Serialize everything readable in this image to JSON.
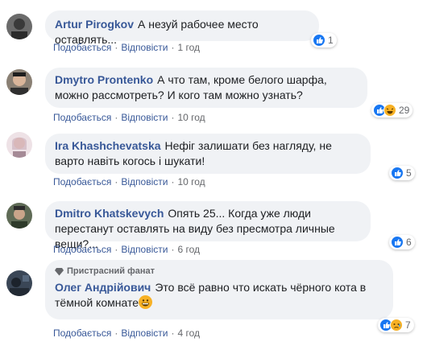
{
  "comments": [
    {
      "author": "Artur Pirogkov",
      "text": "А незуй рабочее место оставлять...",
      "actions": {
        "like": "Подобається",
        "reply": "Відповісти",
        "time": "1 год"
      },
      "reaction_count": "1",
      "avatar_color": "#4a4a4a"
    },
    {
      "author": "Dmytro Prontenko",
      "text": "А что там, кроме белого шарфа, можно рассмотреть? И кого там можно узнать?",
      "actions": {
        "like": "Подобається",
        "reply": "Відповісти",
        "time": "10 год"
      },
      "reaction_count": "29",
      "avatar_color": "#5c4a3a"
    },
    {
      "author": "Ira Khashchevatska",
      "text": "Нефіг залишати без нагляду, не варто навіть когось і шукати!",
      "actions": {
        "like": "Подобається",
        "reply": "Відповісти",
        "time": "10 год"
      },
      "reaction_count": "5",
      "avatar_color": "#d9b8c4"
    },
    {
      "author": "Dmitro Khatskevych",
      "text": "Опять 25... Когда уже люди перестанут оставлять на виду без пресмотра личные вещи?...",
      "actions": {
        "like": "Подобається",
        "reply": "Відповісти",
        "time": "6 год"
      },
      "reaction_count": "6",
      "avatar_color": "#3e4a3a"
    },
    {
      "badge": "Пристрасний фанат",
      "author": "Олег Андрійович",
      "text": "Это всё равно что искать чёрного кота в тёмной комнате",
      "actions": {
        "like": "Подобається",
        "reply": "Відповісти",
        "time": "4 год"
      },
      "reaction_count": "7",
      "avatar_color": "#2c3440"
    }
  ],
  "colors": {
    "link": "#385898",
    "like": "#1877f2",
    "bubble": "#f0f2f5",
    "muted": "#65676b"
  }
}
